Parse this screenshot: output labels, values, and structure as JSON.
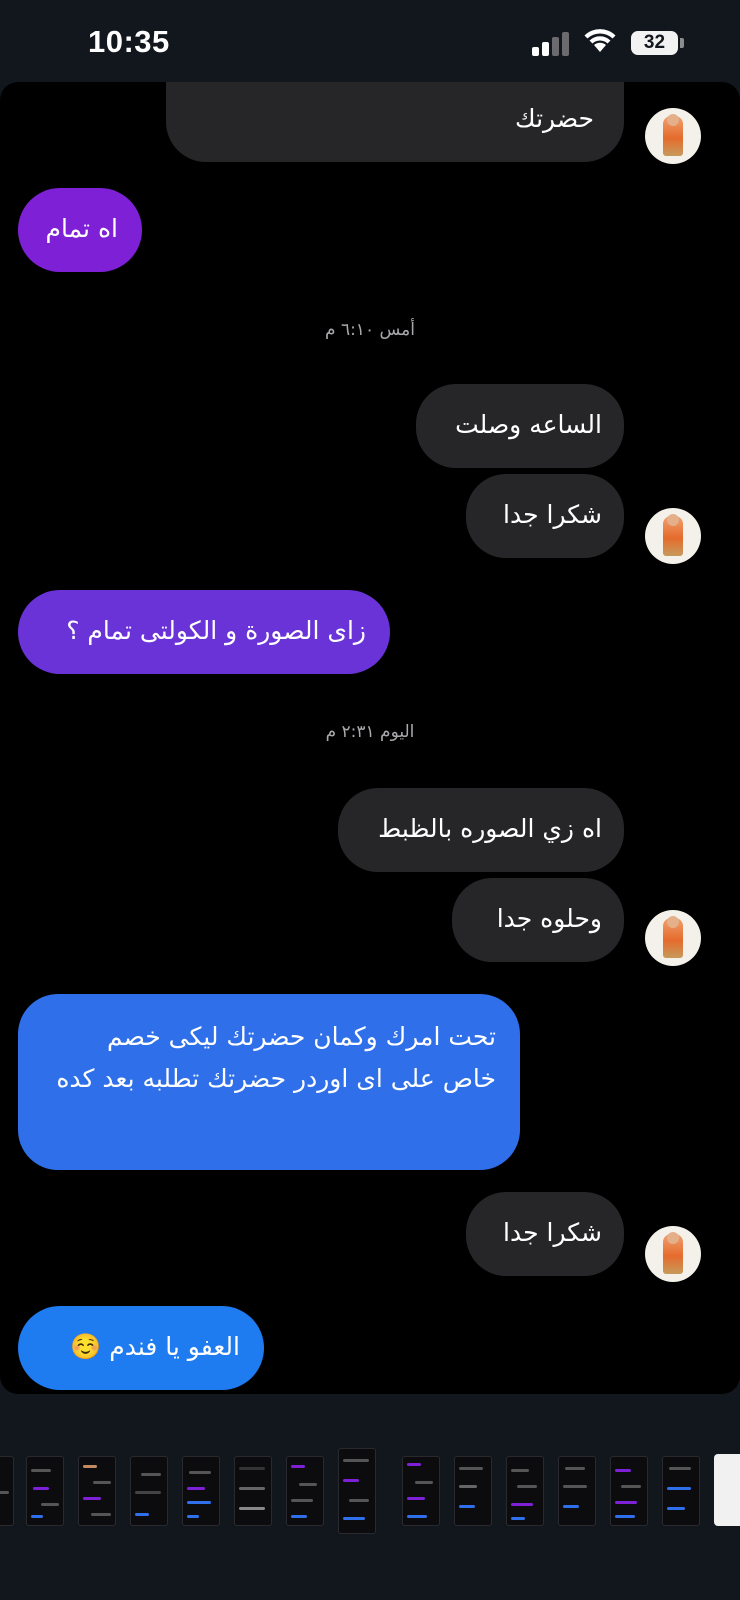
{
  "status_bar": {
    "time": "10:35",
    "battery_level": "32",
    "icons": [
      "cellular-signal-icon",
      "wifi-icon",
      "battery-icon"
    ]
  },
  "colors": {
    "incoming_bubble": "#262628",
    "outgoing_purple": "#7e20d6",
    "outgoing_violet": "#6a33d8",
    "outgoing_blue": "#2f6fe9",
    "outgoing_azure": "#1f7cf0"
  },
  "messages": [
    {
      "text": "حضرتك"
    },
    {
      "text": "اه تمام"
    },
    {
      "text": "الساعه وصلت"
    },
    {
      "text": "شكرا جدا"
    },
    {
      "text": "زاى الصورة و الكولتى تمام ؟"
    },
    {
      "text": "اه زي الصوره بالظبط"
    },
    {
      "text": "وحلوه جدا"
    },
    {
      "text": "تحت امرك وكمان حضرتك ليكى خصم خاص على اى اوردر حضرتك تطلبه بعد كده"
    },
    {
      "text": "شكرا جدا"
    },
    {
      "text": "العفو يا فندم ☺️"
    }
  ],
  "timestamps": [
    {
      "text": "أمس ٦:١٠ م"
    },
    {
      "text": "اليوم ٢:٣١ م"
    }
  ],
  "thumbnails": {
    "count_visible": 15
  }
}
